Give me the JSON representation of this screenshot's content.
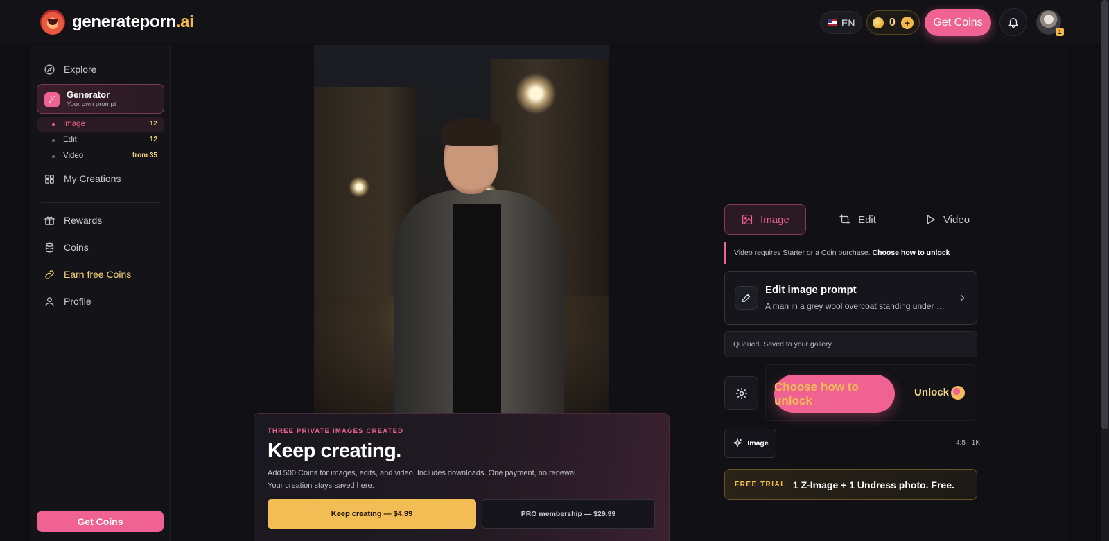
{
  "brand": {
    "name": "generateporn",
    "tld": ".ai"
  },
  "header": {
    "language": "EN",
    "coin_balance": "0",
    "get_coins_label": "Get Coins",
    "notification_badge": "1"
  },
  "sidebar": {
    "explore": "Explore",
    "generator": {
      "title": "Generator",
      "subtitle": "Your own prompt"
    },
    "sub_items": [
      {
        "label": "Image",
        "count": "12"
      },
      {
        "label": "Edit",
        "count": "12"
      },
      {
        "label": "Video",
        "count": "from 35"
      }
    ],
    "my_creations": "My Creations",
    "rewards": "Rewards",
    "coins": "Coins",
    "earn_free_coins": "Earn free Coins",
    "profile": "Profile",
    "get_coins_label": "Get Coins"
  },
  "promo": {
    "eyebrow": "THREE PRIVATE IMAGES CREATED",
    "title": "Keep creating.",
    "desc_line1": "Add 500 Coins for images, edits, and video. Includes downloads. One payment, no renewal.",
    "desc_line2": "Your creation stays saved here.",
    "primary_button": "Keep creating — $4.99",
    "secondary_button": "PRO membership — $29.99"
  },
  "panel": {
    "tabs": [
      {
        "label": "Image"
      },
      {
        "label": "Edit"
      },
      {
        "label": "Video"
      }
    ],
    "notice_text": "Video requires Starter or a Coin purchase.",
    "notice_link": "Choose how to unlock",
    "prompt_title": "Edit image prompt",
    "prompt_text": "A man in a grey wool overcoat standing under a street lamp on a rainy cobblestone street at night",
    "queued_text": "Queued. Saved to your gallery.",
    "choose_unlock": "Choose how to unlock",
    "unlock_label": "Unlock",
    "image_chip": "Image",
    "ratio": "4:5 · 1K",
    "trial_tag": "FREE TRIAL",
    "trial_text": "1 Z-Image + 1 Undress photo. Free."
  },
  "colors": {
    "accent_pink": "#f06292",
    "accent_gold": "#f2bd55",
    "background": "#0f0f13"
  }
}
